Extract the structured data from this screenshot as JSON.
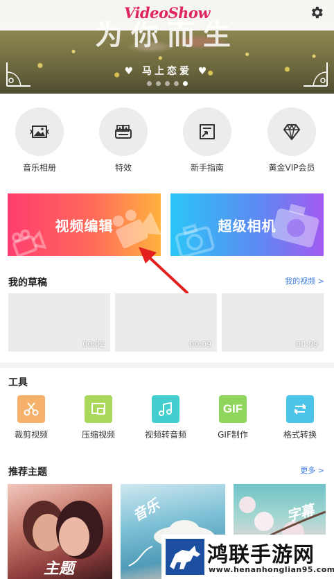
{
  "header": {
    "logo": "VideoShow",
    "banner_title": "为你而生",
    "banner_subtitle": "♥ 马上恋爱 ♥",
    "carousel": {
      "count": 5,
      "active_index": 4
    }
  },
  "quick_menu": [
    {
      "label": "音乐相册",
      "icon": "photo-album-icon"
    },
    {
      "label": "特效",
      "icon": "effects-icon"
    },
    {
      "label": "新手指南",
      "icon": "guide-icon"
    },
    {
      "label": "黄金VIP会员",
      "icon": "diamond-icon"
    }
  ],
  "cards": {
    "edit": {
      "label": "视频编辑",
      "icon": "video-camera-icon",
      "colors": [
        "#ff3d6e",
        "#ffb23f"
      ]
    },
    "camera": {
      "label": "超级相机",
      "icon": "camera-icon",
      "colors": [
        "#2bc6f7",
        "#a25af0"
      ]
    }
  },
  "drafts": {
    "title": "我的草稿",
    "link": "我的视频 >",
    "items": [
      {
        "duration": "00:02"
      },
      {
        "duration": "00:09"
      },
      {
        "duration": "00:09"
      }
    ]
  },
  "tools": {
    "title": "工具",
    "items": [
      {
        "label": "裁剪视频",
        "icon": "scissors-icon",
        "color": "#f5b06a"
      },
      {
        "label": "压缩视频",
        "icon": "compress-icon",
        "color": "#a9d85a"
      },
      {
        "label": "视频转音频",
        "icon": "music-note-icon",
        "color": "#43cfd0"
      },
      {
        "label": "GIF制作",
        "icon": "gif-icon",
        "color": "#8fd55b",
        "glyph": "GIF"
      },
      {
        "label": "格式转换",
        "icon": "convert-icon",
        "color": "#4cc3e8"
      }
    ]
  },
  "themes": {
    "title": "推荐主题",
    "link": "更多 >",
    "items": [
      {
        "label": "主题"
      },
      {
        "label": "音乐"
      },
      {
        "label": "字幕"
      }
    ]
  },
  "watermark": {
    "title": "鸿联手游网",
    "url": "www.henanhonglian95.com"
  },
  "colors": {
    "accent_link": "#3a7be0",
    "logo": "#e0245e",
    "annotation_arrow": "#e3201f"
  }
}
